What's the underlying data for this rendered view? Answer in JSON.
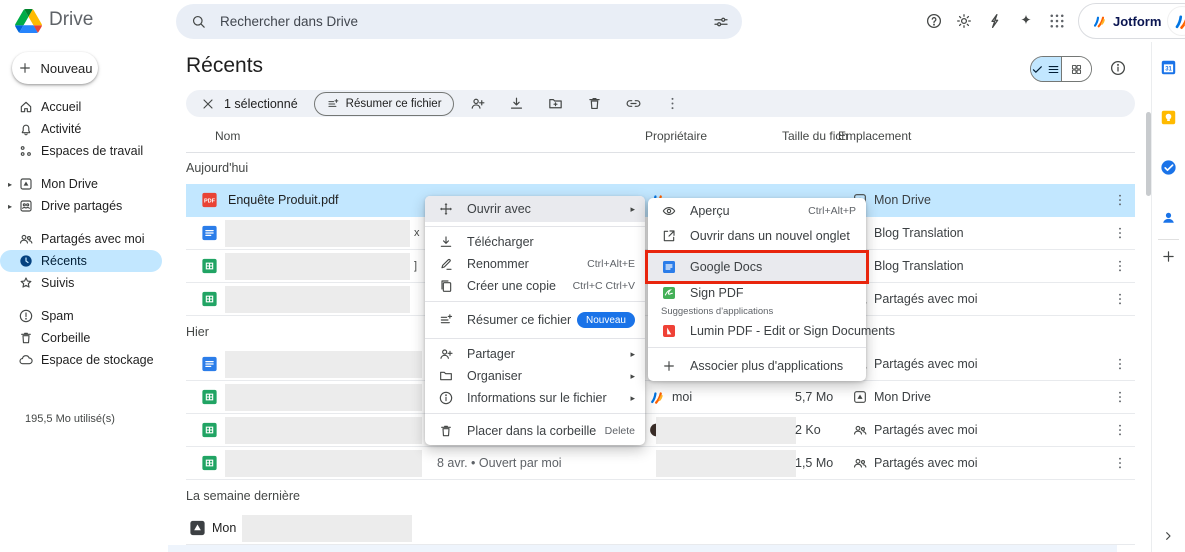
{
  "colors": {
    "selection_blue": "#c2e7ff",
    "badge_new_blue": "#1a73e8",
    "annotation_red": "#e8250d",
    "pdf_red": "#e94335",
    "docs_blue": "#2b7de9",
    "sheets_green": "#21a464"
  },
  "header": {
    "app_name": "Drive",
    "search": {
      "placeholder": "Rechercher dans Drive"
    },
    "account_label": "Jotform"
  },
  "sidebar": {
    "new_button_label": "Nouveau",
    "groups": [
      {
        "items": [
          {
            "icon": "home",
            "label": "Accueil"
          },
          {
            "icon": "bell",
            "label": "Activité"
          },
          {
            "icon": "workspaces",
            "label": "Espaces de travail"
          }
        ]
      },
      {
        "items": [
          {
            "icon": "mydrive",
            "label": "Mon Drive",
            "expand": true
          },
          {
            "icon": "shareddrive",
            "label": "Drive partagés",
            "expand": true
          }
        ]
      },
      {
        "items": [
          {
            "icon": "people",
            "label": "Partagés avec moi"
          },
          {
            "icon": "clock-filled",
            "label": "Récents",
            "selected": true
          },
          {
            "icon": "star",
            "label": "Suivis"
          }
        ]
      },
      {
        "items": [
          {
            "icon": "spam",
            "label": "Spam"
          },
          {
            "icon": "trash",
            "label": "Corbeille"
          },
          {
            "icon": "cloud",
            "label": "Espace de stockage"
          }
        ]
      }
    ],
    "storage_note": "195,5 Mo utilisé(s)"
  },
  "page": {
    "title": "Récents"
  },
  "toolbar": {
    "selected_count": "1 sélectionné",
    "summarize_label": "Résumer ce fichier"
  },
  "table": {
    "columns": {
      "name": "Nom",
      "owner": "Propriétaire",
      "size": "Taille du fich",
      "location": "Emplacement"
    }
  },
  "list": [
    {
      "type": "section",
      "label": "Aujourd'hui"
    },
    {
      "type": "file",
      "icon": "pdf-file",
      "name": "Enquête Produit.pdf",
      "selected": true,
      "owner": {
        "icon": "jotform-mini"
      },
      "location": {
        "icon": "mydrive-loc",
        "label": "Mon Drive"
      }
    },
    {
      "type": "file",
      "icon": "docs-file",
      "name_redacted": true,
      "name_fragment": "x",
      "location": {
        "icon": "folder-loc",
        "label": "Blog Translation"
      }
    },
    {
      "type": "file",
      "icon": "sheets-file",
      "name_redacted": true,
      "name_fragment": "]",
      "location": {
        "icon": "folder-loc",
        "label": "Blog Translation"
      }
    },
    {
      "type": "file",
      "icon": "sheets-file",
      "name_redacted": true,
      "location": {
        "icon": "people-loc",
        "label": "Partagés avec moi"
      }
    },
    {
      "type": "section",
      "label": "Hier"
    },
    {
      "type": "file",
      "icon": "docs-file",
      "name_redacted": true,
      "location": {
        "icon": "people-loc",
        "label": "Partagés avec moi"
      }
    },
    {
      "type": "file",
      "icon": "sheets-file",
      "name_redacted": true,
      "owner": {
        "icon": "jotform-mini",
        "label": "moi"
      },
      "size": "5,7 Mo",
      "location": {
        "icon": "mydrive-loc",
        "label": "Mon Drive"
      }
    },
    {
      "type": "file",
      "icon": "sheets-file",
      "name_redacted": true,
      "owner": {
        "icon": "avatar-dark",
        "redacted": true
      },
      "size": "2 Ko",
      "location": {
        "icon": "people-loc",
        "label": "Partagés avec moi"
      }
    },
    {
      "type": "file",
      "icon": "sheets-file",
      "name_redacted": true,
      "owner": {
        "redacted": true
      },
      "size": "1,5 Mo",
      "note": "8 avr. • Ouvert par moi",
      "location": {
        "icon": "people-loc",
        "label": "Partagés avec moi"
      }
    },
    {
      "type": "section",
      "label": "La semaine dernière"
    },
    {
      "type": "file",
      "icon": "mydrive-dark",
      "name": "Mon",
      "name_redacted": true,
      "no_kebab": true
    }
  ],
  "context_menu": {
    "items": [
      {
        "icon": "open-with",
        "label": "Ouvrir avec",
        "arrow": true,
        "hover": true,
        "h": "h26"
      },
      {
        "divider": true
      },
      {
        "icon": "download",
        "label": "Télécharger"
      },
      {
        "icon": "pencil",
        "label": "Renommer",
        "shortcut": "Ctrl+Alt+E"
      },
      {
        "icon": "copy",
        "label": "Créer une copie",
        "shortcut": "Ctrl+C Ctrl+V"
      },
      {
        "divider": true
      },
      {
        "icon": "summarize",
        "label": "Résumer ce fichier",
        "badge": "Nouveau",
        "h": "h28"
      },
      {
        "divider": true
      },
      {
        "icon": "person-add",
        "label": "Partager",
        "arrow": true
      },
      {
        "icon": "folder-loc",
        "label": "Organiser",
        "arrow": true
      },
      {
        "icon": "info",
        "label": "Informations sur le fichier",
        "arrow": true
      },
      {
        "divider": true
      },
      {
        "icon": "trash",
        "label": "Placer dans la corbeille",
        "shortcut": "Delete",
        "h": "h26"
      }
    ]
  },
  "submenu": {
    "items": [
      {
        "icon": "eye",
        "label": "Aperçu",
        "shortcut": "Ctrl+Alt+P",
        "h": "h26"
      },
      {
        "icon": "open-new",
        "label": "Ouvrir dans un nouvel onglet",
        "h": "h24"
      },
      {
        "divider": true,
        "m2": true
      },
      {
        "icon": "docs-file",
        "label": "Google Docs",
        "hover": true,
        "annotated": true,
        "h": "h28"
      },
      {
        "icon": "signpdf",
        "label": "Sign PDF",
        "h": "h24"
      },
      {
        "label_small": "Suggestions d'applications"
      },
      {
        "icon": "lumin",
        "label": "Lumin PDF - Edit or Sign Documents",
        "h": "h24"
      },
      {
        "divider": true
      },
      {
        "icon": "plus",
        "label": "Associer plus d'applications",
        "h": "h28"
      }
    ]
  },
  "side_panel": {
    "calendar_day": "31",
    "icons": [
      "calendar",
      "keep",
      "tasks",
      "contacts"
    ]
  }
}
